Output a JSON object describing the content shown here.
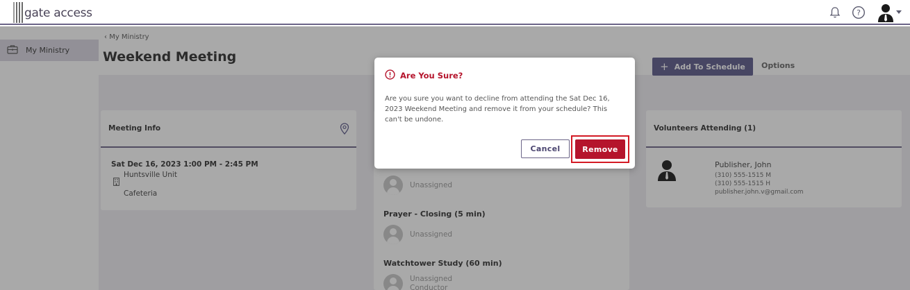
{
  "header": {
    "logo_text": "gate access",
    "icons": [
      "bell-icon",
      "help-icon",
      "user-avatar-icon",
      "caret-down-icon"
    ]
  },
  "sidebar": {
    "items": [
      {
        "label": "My Ministry",
        "icon": "briefcase-icon"
      }
    ]
  },
  "main": {
    "breadcrumb": "My Ministry",
    "title": "Weekend Meeting",
    "add_button_label": "Add To Schedule",
    "options_label": "Options",
    "meeting_info": {
      "title": "Meeting Info",
      "datetime": "Sat Dec 16, 2023 1:00 PM - 2:45 PM",
      "location": "Huntsville Unit",
      "room": "Cafeteria"
    },
    "schedule": {
      "items": [
        {
          "status": "Unassigned"
        },
        {
          "title": "Prayer - Closing (5 min)",
          "status": "Unassigned"
        },
        {
          "title": "Watchtower Study (60 min)",
          "status": "Unassigned",
          "role": "Conductor"
        }
      ]
    },
    "volunteers": {
      "title": "Volunteers Attending (1)",
      "list": [
        {
          "name": "Publisher, John",
          "phone_mobile": "(310) 555-1515 M",
          "phone_home": "(310) 555-1515 H",
          "email": "publisher.john.v@gmail.com"
        }
      ]
    }
  },
  "modal": {
    "title": "Are You Sure?",
    "message": "Are you sure you want to decline from attending the Sat Dec 16, 2023 Weekend Meeting and remove it from your schedule? This can't be undone.",
    "cancel_label": "Cancel",
    "remove_label": "Remove",
    "accent_color": "#b5142c"
  }
}
